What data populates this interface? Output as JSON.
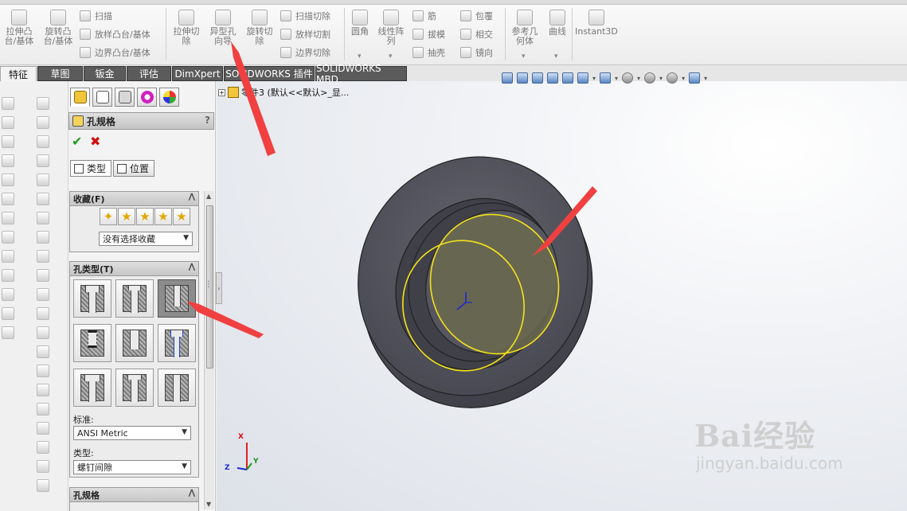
{
  "ribbon": {
    "extrude_boss": "拉伸凸\n台/基体",
    "revolve_boss": "旋转凸\n台/基体",
    "sweep": "扫描",
    "loft_boss": "放样凸台/基体",
    "boundary_boss": "边界凸台/基体",
    "extrude_cut": "拉伸切\n除",
    "hole_wizard": "异型孔\n向导",
    "revolve_cut": "旋转切\n除",
    "sweep_cut": "扫描切除",
    "loft_cut": "放样切割",
    "boundary_cut": "边界切除",
    "fillet": "圆角",
    "linear_pattern": "线性阵\n列",
    "rib": "筋",
    "draft": "拔模",
    "shell": "抽壳",
    "wrap": "包覆",
    "intersect": "相交",
    "mirror": "镜向",
    "reference_geometry": "参考几\n何体",
    "curves": "曲线",
    "instant3d": "Instant3D"
  },
  "tabs": {
    "feature": "特征",
    "sketch": "草图",
    "sheet_metal": "钣金",
    "evaluate": "评估",
    "dimxpert": "DimXpert",
    "sw_addins": "SOLIDWORKS 插件",
    "sw_mbd": "SOLIDWORKS MBD"
  },
  "property_manager": {
    "title": "孔规格",
    "help": "?",
    "ok": "✔",
    "cancel": "✖",
    "tab_type": "类型",
    "tab_position": "位置",
    "favorites": {
      "header": "收藏(F)",
      "selected": "没有选择收藏"
    },
    "hole_type": {
      "header": "孔类型(T)",
      "standard_label": "标准:",
      "standard_value": "ANSI Metric",
      "type_label": "类型:",
      "type_value": "螺钉间隙"
    },
    "hole_spec_header": "孔规格"
  },
  "tree": {
    "expander": "+",
    "node_label": "零件3 (默认<<默认>_显..."
  },
  "triad": {
    "x": "X",
    "y": "Y",
    "z": "Z"
  },
  "watermark": {
    "logo": "Bai经验",
    "url": "jingyan.baidu.com"
  },
  "colors": {
    "annotation_arrow": "#f04040",
    "model_body": "#4f5059",
    "selected_edge": "#f5e21a"
  }
}
